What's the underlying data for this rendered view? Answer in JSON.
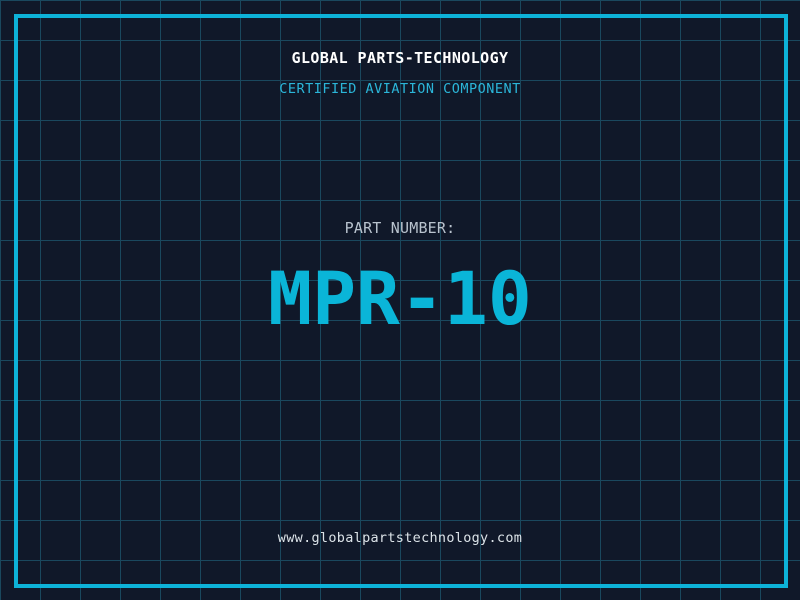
{
  "header": {
    "company_name": "GLOBAL PARTS-TECHNOLOGY",
    "certification": "CERTIFIED AVIATION COMPONENT"
  },
  "part": {
    "label": "PART NUMBER:",
    "number": "MPR-10"
  },
  "footer": {
    "website": "www.globalpartstechnology.com"
  },
  "colors": {
    "background": "#101829",
    "grid_line": "#1a485e",
    "frame": "#0db2d8",
    "accent_cyan": "#0ab5d8",
    "subtitle_cyan": "#2bb6d9",
    "label_gray": "#b9c3ce",
    "title_white": "#ffffff",
    "footer_light": "#dce3e8"
  }
}
